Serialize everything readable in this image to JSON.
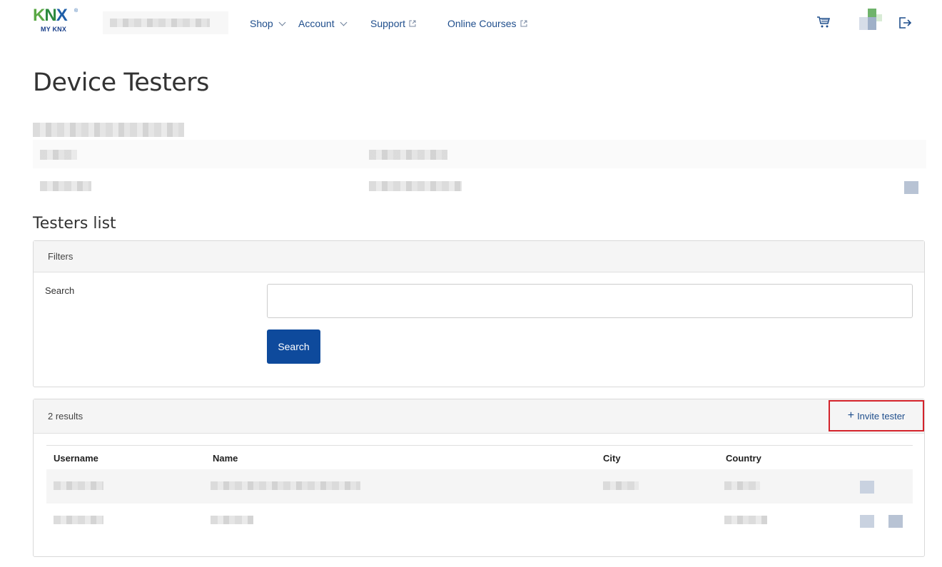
{
  "header": {
    "logo_text": "KNX",
    "logo_sub": "MY KNX",
    "nav": [
      {
        "label": "Shop",
        "type": "dropdown"
      },
      {
        "label": "Account",
        "type": "dropdown"
      },
      {
        "label": "Support",
        "type": "external"
      },
      {
        "label": "Online Courses",
        "type": "external"
      }
    ],
    "icons": [
      "cart-icon",
      "avatar",
      "logout-icon"
    ]
  },
  "page": {
    "title": "Device Testers"
  },
  "testers_list": {
    "title": "Testers list",
    "filters": {
      "header": "Filters",
      "search_label": "Search",
      "search_value": "",
      "search_button": "Search"
    },
    "results": {
      "count_label": "2 results",
      "invite_label": "Invite tester",
      "columns": [
        "Username",
        "Name",
        "City",
        "Country"
      ]
    }
  },
  "colors": {
    "primary": "#0e4a9c",
    "link": "#1f4e8c",
    "highlight": "#d4232b"
  }
}
